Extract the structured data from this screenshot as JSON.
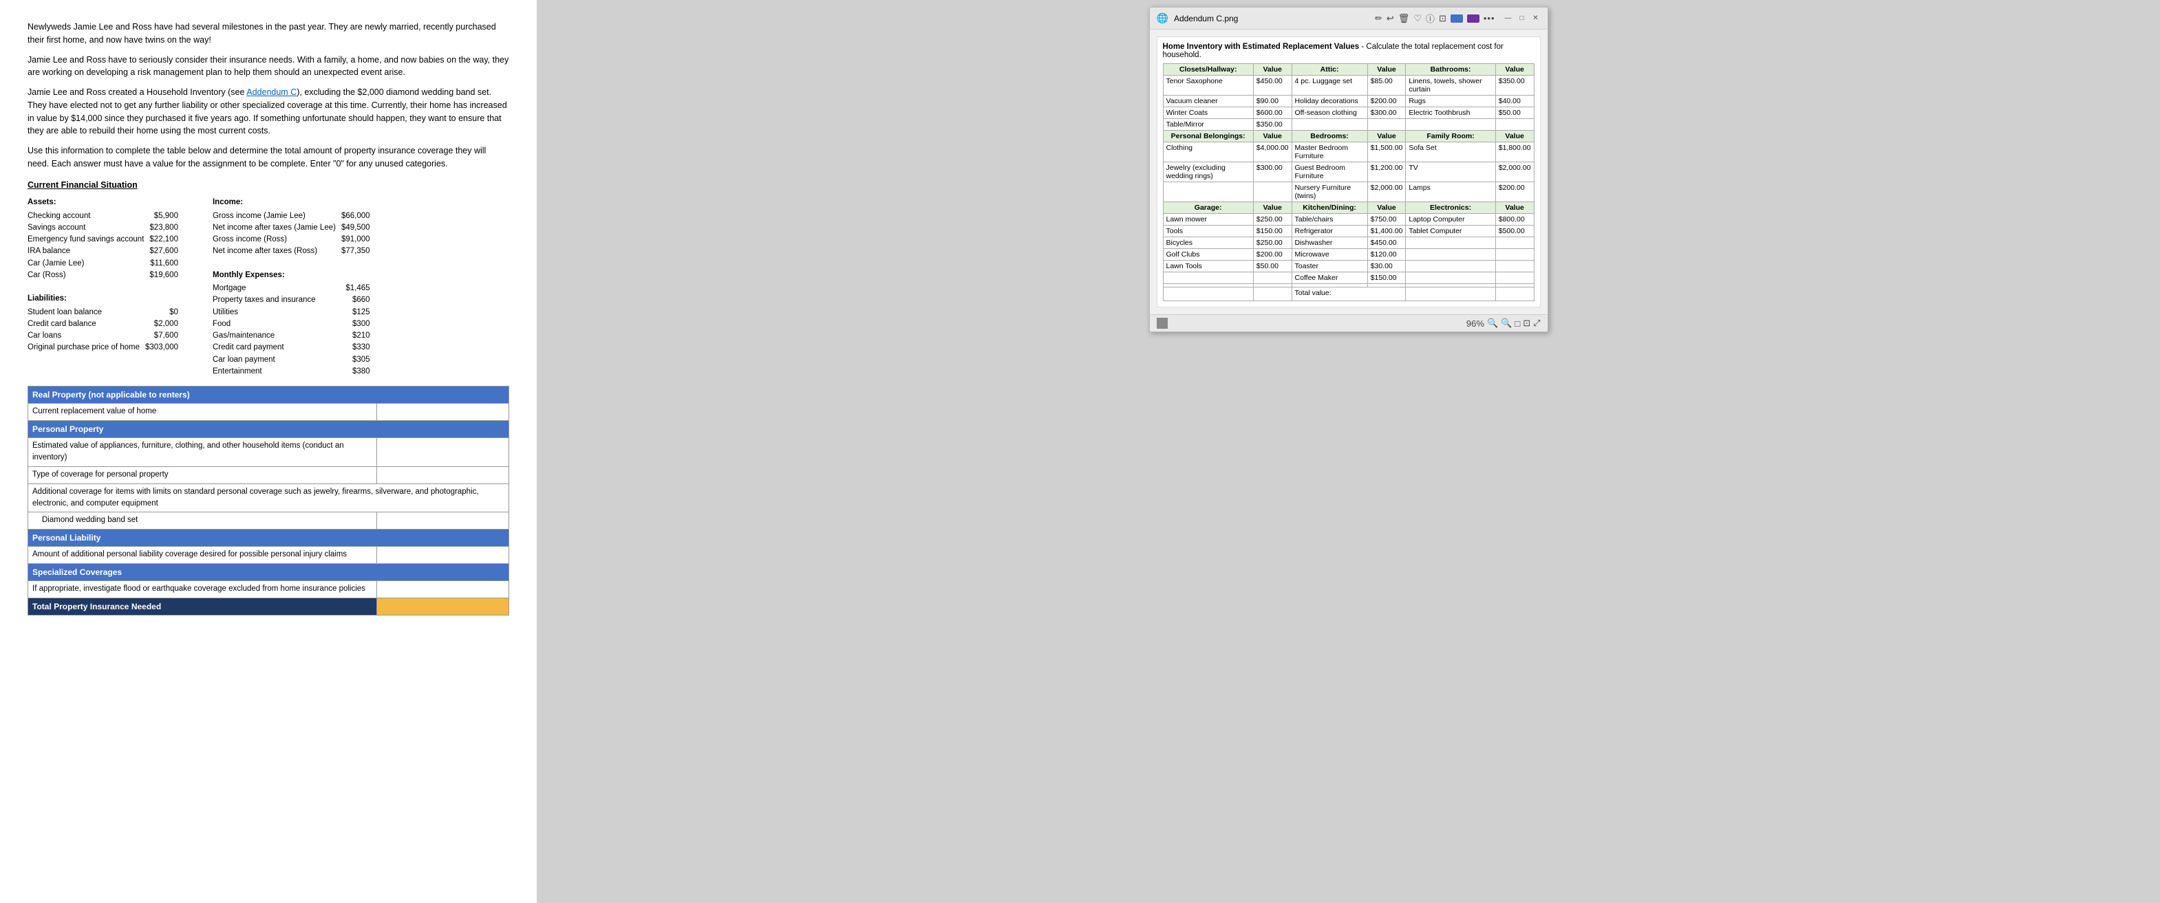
{
  "document": {
    "paragraphs": [
      "Newlyweds Jamie Lee and Ross have had several milestones in the past year. They are newly married, recently purchased their first home, and now have twins on the way!",
      "Jamie Lee and Ross have to seriously consider their insurance needs. With a family, a home, and now babies on the way, they are working on developing a risk management plan to help them should an unexpected event arise.",
      "Jamie Lee and Ross created a Household Inventory (see Addendum C), excluding the $2,000 diamond wedding band set. They have elected not to get any further liability or other specialized coverage at this time. Currently, their home has increased in value by $14,000 since they purchased it five years ago. If something unfortunate should happen, they want to ensure that they are able to rebuild their home using the most current costs.",
      "Use this information to complete the table below and determine the total amount of property insurance coverage they will need. Each answer must have a value for the assignment to be complete. Enter \"0\" for any unused categories."
    ],
    "section_title": "Current Financial Situation",
    "assets": {
      "title": "Assets:",
      "items": [
        {
          "label": "Checking account",
          "value": "$5,900"
        },
        {
          "label": "Savings account",
          "value": "$23,800"
        },
        {
          "label": "Emergency fund savings account",
          "value": "$22,100"
        },
        {
          "label": "IRA balance",
          "value": "$27,600"
        },
        {
          "label": "Car (Jamie Lee)",
          "value": "$11,600"
        },
        {
          "label": "Car (Ross)",
          "value": "$19,600"
        }
      ]
    },
    "liabilities": {
      "title": "Liabilities:",
      "items": [
        {
          "label": "Student loan balance",
          "value": "$0"
        },
        {
          "label": "Credit card balance",
          "value": "$2,000"
        },
        {
          "label": "Car loans",
          "value": "$7,600"
        },
        {
          "label": "Original purchase price of home",
          "value": "$303,000"
        }
      ]
    },
    "income": {
      "title": "Income:",
      "items": [
        {
          "label": "Gross income (Jamie Lee)",
          "value": "$66,000"
        },
        {
          "label": "Net income after taxes (Jamie Lee)",
          "value": "$49,500"
        },
        {
          "label": "Gross income (Ross)",
          "value": "$91,000"
        },
        {
          "label": "Net income after taxes (Ross)",
          "value": "$77,350"
        }
      ]
    },
    "expenses": {
      "title": "Monthly Expenses:",
      "items": [
        {
          "label": "Mortgage",
          "value": "$1,465"
        },
        {
          "label": "Property taxes and insurance",
          "value": "$660"
        },
        {
          "label": "Utilities",
          "value": "$125"
        },
        {
          "label": "Food",
          "value": "$300"
        },
        {
          "label": "Gas/maintenance",
          "value": "$210"
        },
        {
          "label": "Credit card payment",
          "value": "$330"
        },
        {
          "label": "Car loan payment",
          "value": "$305"
        },
        {
          "label": "Entertainment",
          "value": "$380"
        }
      ]
    },
    "insurance_table": {
      "sections": [
        {
          "header": "Real Property (not applicable to renters)",
          "header_class": "header-blue",
          "rows": [
            {
              "label": "Current replacement value of home",
              "input": true
            }
          ]
        },
        {
          "header": "Personal Property",
          "header_class": "header-blue",
          "rows": [
            {
              "label": "Estimated value of appliances, furniture, clothing, and other household items (conduct an inventory)",
              "input": true
            },
            {
              "label": "Type of coverage for personal property",
              "input": true
            },
            {
              "label": "Additional coverage for items with limits on standard personal coverage such as jewelry, firearms, silverware, and photographic, electronic, and computer equipment",
              "input": false
            },
            {
              "label": "Diamond wedding band set",
              "input": true,
              "indent": true
            }
          ]
        },
        {
          "header": "Personal Liability",
          "header_class": "header-blue",
          "rows": [
            {
              "label": "Amount of additional personal liability coverage desired for possible personal injury claims",
              "input": true
            }
          ]
        },
        {
          "header": "Specialized Coverages",
          "header_class": "header-blue",
          "rows": [
            {
              "label": "If appropriate, investigate flood or earthquake coverage excluded from home insurance policies",
              "input": true
            }
          ]
        },
        {
          "header": "Total Property Insurance Needed",
          "header_class": "header-dark-blue",
          "rows": [],
          "total": true
        }
      ]
    }
  },
  "window": {
    "title": "Addendum C.png",
    "zoom": "96%",
    "inventory": {
      "title": "Home Inventory with Estimated Replacement Values",
      "subtitle": " - Calculate the total replacement cost for household.",
      "sections": {
        "closets_hallway": {
          "header": "Closets/Hallway:",
          "value_header": "Value",
          "items": [
            {
              "name": "Tenor Saxophone",
              "value": "$450.00"
            },
            {
              "name": "Vacuum cleaner",
              "value": "$90.00"
            },
            {
              "name": "Winter Coats",
              "value": "$600.00"
            },
            {
              "name": "Table/Mirror",
              "value": "$350.00"
            }
          ]
        },
        "attic": {
          "header": "Attic:",
          "value_header": "Value",
          "items": [
            {
              "name": "4 pc. Luggage set",
              "value": "$85.00"
            },
            {
              "name": "Holiday decorations",
              "value": "$200.00"
            },
            {
              "name": "Off-season clothing",
              "value": "$300.00"
            }
          ]
        },
        "bathrooms": {
          "header": "Bathrooms:",
          "value_header": "Value",
          "items": [
            {
              "name": "Linens, towels, shower curtain",
              "value": "$350.00"
            },
            {
              "name": "Rugs",
              "value": "$40.00"
            },
            {
              "name": "Electric Toothbrush",
              "value": "$50.00"
            }
          ]
        },
        "personal_belongings": {
          "header": "Personal Belongings:",
          "value_header": "Value",
          "items": [
            {
              "name": "Clothing",
              "value": "$4,000.00"
            },
            {
              "name": "Jewelry (excluding wedding rings)",
              "value": "$300.00"
            }
          ]
        },
        "bedrooms": {
          "header": "Bedrooms:",
          "value_header": "Value",
          "items": [
            {
              "name": "Master Bedroom Furniture",
              "value": "$1,500.00"
            },
            {
              "name": "Guest Bedroom Furniture",
              "value": "$1,200.00"
            },
            {
              "name": "Nursery Furniture (twins)",
              "value": "$2,000.00"
            }
          ]
        },
        "family_room": {
          "header": "Family Room:",
          "value_header": "Value",
          "items": [
            {
              "name": "Sofa Set",
              "value": "$1,800.00"
            },
            {
              "name": "TV",
              "value": "$2,000.00"
            },
            {
              "name": "Lamps",
              "value": "$200.00"
            }
          ]
        },
        "garage": {
          "header": "Garage:",
          "value_header": "Value",
          "items": [
            {
              "name": "Lawn mower",
              "value": "$250.00"
            },
            {
              "name": "Tools",
              "value": "$150.00"
            },
            {
              "name": "Bicycles",
              "value": "$250.00"
            },
            {
              "name": "Golf Clubs",
              "value": "$200.00"
            },
            {
              "name": "Lawn Tools",
              "value": "$50.00"
            }
          ]
        },
        "kitchen_dining": {
          "header": "Kitchen/Dining:",
          "value_header": "Value",
          "items": [
            {
              "name": "Table/chairs",
              "value": "$750.00"
            },
            {
              "name": "Refrigerator",
              "value": "$1,400.00"
            },
            {
              "name": "Dishwasher",
              "value": "$450.00"
            },
            {
              "name": "Microwave",
              "value": "$120.00"
            },
            {
              "name": "Toaster",
              "value": "$30.00"
            },
            {
              "name": "Coffee Maker",
              "value": "$150.00"
            }
          ]
        },
        "electronics": {
          "header": "Electronics:",
          "value_header": "Value",
          "items": [
            {
              "name": "Laptop Computer",
              "value": "$800.00"
            },
            {
              "name": "Tablet Computer",
              "value": "$500.00"
            }
          ]
        }
      },
      "total_label": "Total value:"
    }
  },
  "icons": {
    "minimize": "—",
    "maximize": "□",
    "close": "✕",
    "zoom_in": "🔍",
    "zoom_out": "🔍",
    "page": "□",
    "toolbar_edit": "✏",
    "toolbar_undo": "↩",
    "toolbar_trash": "🗑",
    "toolbar_heart": "♡",
    "toolbar_info": "ⓘ",
    "toolbar_share": "⊡",
    "toolbar_cloud1": "☁",
    "toolbar_cloud2": "☁",
    "toolbar_more": "•••"
  }
}
